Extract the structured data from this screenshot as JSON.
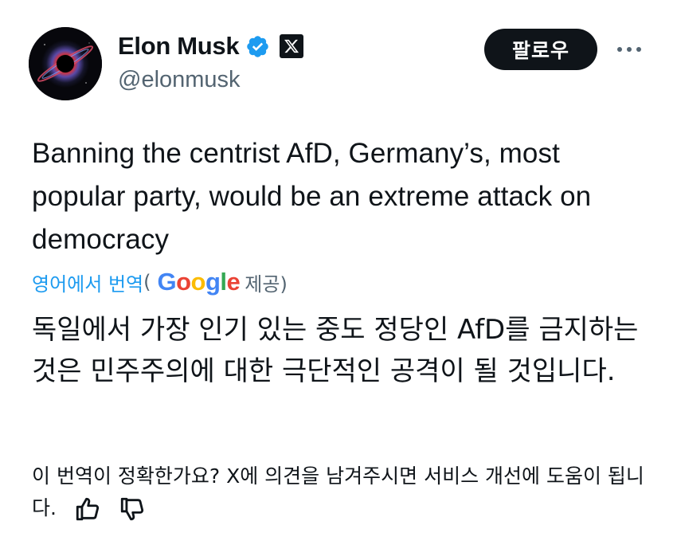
{
  "author": {
    "display_name": "Elon Musk",
    "handle": "@elonmusk",
    "avatar_icon": "black-hole-avatar",
    "verified_icon": "verified-badge-icon",
    "affiliation_icon": "x-logo-icon",
    "verified_color": "#1d9bf0"
  },
  "actions": {
    "follow_label": "팔로우",
    "more_icon": "more-dots-icon"
  },
  "tweet": {
    "text": "Banning the centrist AfD, Germany’s, most popular party, would be an extreme attack on democracy"
  },
  "translation": {
    "link_label": "영어에서 번역",
    "open_paren": "(",
    "provider": "Google",
    "provided_label": "제공)",
    "text": "독일에서 가장 인기 있는 중도 정당인 AfD를 금지하는 것은 민주주의에 대한 극단적인 공격이 될 것입니다."
  },
  "feedback": {
    "prompt": "이 번역이 정확한가요? X에 의견을 남겨주시면 서비스 개선에 도움이 됩니다.",
    "thumbs_up_icon": "thumbs-up-icon",
    "thumbs_down_icon": "thumbs-down-icon"
  }
}
